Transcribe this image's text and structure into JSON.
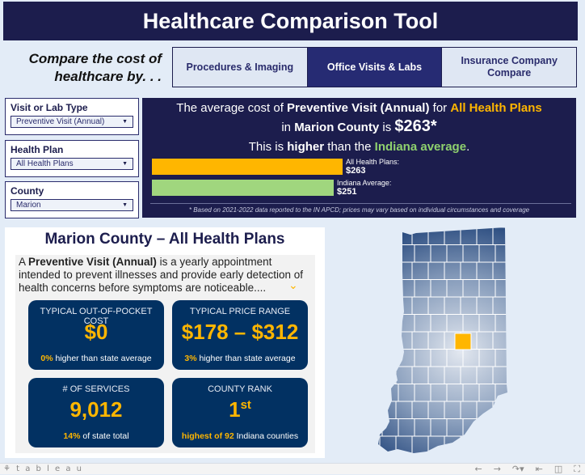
{
  "header": {
    "title": "Healthcare Comparison Tool"
  },
  "compare_prompt": "Compare the cost of healthcare by. . .",
  "tabs": [
    {
      "label": "Procedures & Imaging",
      "active": false
    },
    {
      "label": "Office Visits & Labs",
      "active": true
    },
    {
      "label": "Insurance Company Compare",
      "active": false
    }
  ],
  "filters": {
    "visit_type": {
      "label": "Visit or Lab Type",
      "value": "Preventive Visit (Annual)"
    },
    "health_plan": {
      "label": "Health Plan",
      "value": "All Health Plans"
    },
    "county": {
      "label": "County",
      "value": "Marion"
    }
  },
  "summary": {
    "l1_a": "The average cost of ",
    "l1_service": "Preventive Visit (Annual)",
    "l1_b": " for ",
    "l1_plan": "All Health Plans",
    "l2_a": "in ",
    "l2_county": "Marion County",
    "l2_b": " is ",
    "l2_price": "$263*",
    "l3_a": "This is ",
    "l3_cmp": "higher",
    "l3_b": " than the ",
    "l3_ref": "Indiana average",
    "l3_c": ".",
    "footnote": "* Based on 2021-2022 data reported to the IN APCD; prices may vary based on individual circumstances and coverage",
    "colors": {
      "plan_bar": "#ffb600",
      "state_bar": "#a0d67e"
    }
  },
  "chart_data": {
    "type": "bar",
    "orientation": "horizontal",
    "categories": [
      "All Health Plans",
      "Indiana Average"
    ],
    "values": [
      263,
      251
    ],
    "value_labels": [
      "$263",
      "$251"
    ],
    "category_labels": [
      "All Health Plans:",
      "Indiana Average:"
    ],
    "title": "",
    "xlabel": "",
    "ylabel": "",
    "xlim": [
      0,
      263
    ]
  },
  "county_panel": {
    "title": "Marion County – All Health Plans",
    "desc_a": "A ",
    "desc_service": "Preventive Visit (Annual)",
    "desc_b": " is a yearly appointment intended to prevent illnesses and provide early detection of health concerns before symptoms are noticeable....",
    "cards": [
      {
        "title": "TYPICAL OUT-OF-POCKET COST",
        "value": "$0",
        "sub_highlight": "0%",
        "sub_text": " higher than state average"
      },
      {
        "title": "TYPICAL PRICE RANGE",
        "value": "$178 – $312",
        "sub_highlight": "3%",
        "sub_text": " higher than state average"
      },
      {
        "title": "# OF SERVICES",
        "value": "9,012",
        "sub_highlight": "14%",
        "sub_text": " of state total"
      },
      {
        "title": "COUNTY RANK",
        "value": "1",
        "value_suffix": "st",
        "sub_highlight": "highest of 92",
        "sub_text": " Indiana counties"
      }
    ]
  },
  "map": {
    "state": "Indiana",
    "highlighted_county": "Marion",
    "highlight_color": "#ffb600"
  },
  "footer": {
    "brand": "⚘ t a b l e a u",
    "icons": [
      "undo-icon",
      "redo-icon",
      "revert-icon",
      "reset-icon",
      "share-icon",
      "fullscreen-icon"
    ]
  }
}
